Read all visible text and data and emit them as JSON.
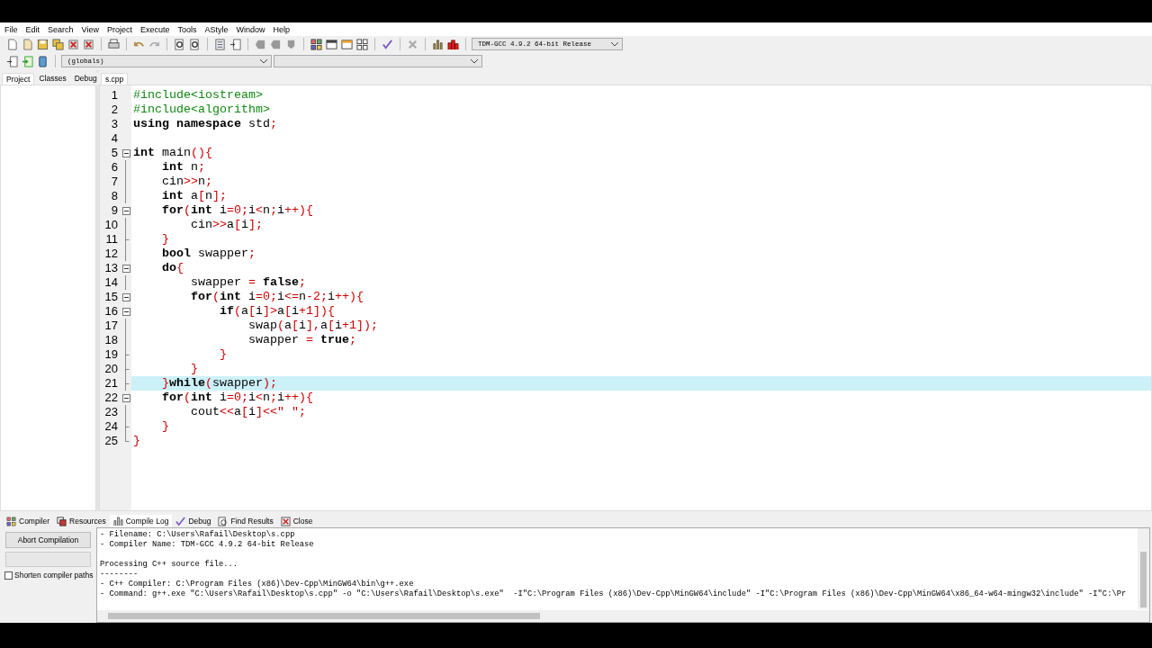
{
  "menu": [
    "File",
    "Edit",
    "Search",
    "View",
    "Project",
    "Execute",
    "Tools",
    "AStyle",
    "Window",
    "Help"
  ],
  "toolbar": {
    "compiler": "TDM-GCC 4.9.2 64-bit Release",
    "scope": "(globals)"
  },
  "side_tabs": [
    {
      "label": "Project",
      "selected": true
    },
    {
      "label": "Classes",
      "selected": false
    },
    {
      "label": "Debug",
      "selected": false
    }
  ],
  "editor_tabs": [
    {
      "label": "s.cpp",
      "selected": true
    }
  ],
  "code": [
    {
      "number": "1",
      "kind": "preprocessor",
      "current": false,
      "text": "#include<iostream>"
    },
    {
      "number": "2",
      "kind": "preprocessor",
      "current": false,
      "text": "#include<algorithm>"
    },
    {
      "number": "3",
      "kind": "plain",
      "current": false,
      "text": "**using namespace** std;"
    },
    {
      "number": "4",
      "kind": "plain",
      "current": false
    },
    {
      "number": "5",
      "kind": "fold-start",
      "current": false,
      "text": "**int** main(){"
    },
    {
      "number": "6",
      "kind": "fold-inside",
      "current": false,
      "text": "    **int** n;"
    },
    {
      "number": "7",
      "kind": "fold-inside",
      "current": false,
      "text": "    cin>>n;"
    },
    {
      "number": "8",
      "kind": "fold-inside",
      "current": false,
      "text": "    **int** a[n];"
    },
    {
      "number": "9",
      "kind": "fold-start",
      "current": false,
      "text": "    **for**(**int** i=0;i<n;i++){"
    },
    {
      "number": "10",
      "kind": "fold-inside",
      "current": false,
      "text": "        cin>>a[i];"
    },
    {
      "number": "11",
      "kind": "fold-end",
      "current": false,
      "text": "    }"
    },
    {
      "number": "12",
      "kind": "fold-inside",
      "current": false,
      "text": "    **bool** swapper;"
    },
    {
      "number": "13",
      "kind": "fold-start",
      "current": false,
      "text": "    **do**{"
    },
    {
      "number": "14",
      "kind": "fold-inside",
      "current": false,
      "text": "        swapper = **false**;"
    },
    {
      "number": "15",
      "kind": "fold-start",
      "current": false,
      "text": "        **for**(**int** i=0;i<=n-2;i++){"
    },
    {
      "number": "16",
      "kind": "fold-start",
      "current": false,
      "text": "            **if**(a[i]>a[i+1]){"
    },
    {
      "number": "17",
      "kind": "fold-inside",
      "current": false,
      "text": "                swap(a[i],a[i+1]);"
    },
    {
      "number": "18",
      "kind": "fold-inside",
      "current": false,
      "text": "                swapper = **true**;"
    },
    {
      "number": "19",
      "kind": "fold-end",
      "current": false,
      "text": "            }"
    },
    {
      "number": "20",
      "kind": "fold-end",
      "current": false,
      "text": "        }"
    },
    {
      "number": "21",
      "kind": "fold-end",
      "current": true,
      "text": "    }**while**(swapper);"
    },
    {
      "number": "22",
      "kind": "fold-start",
      "current": false,
      "text": "    **for**(**int** i=0;i<n;i++){"
    },
    {
      "number": "23",
      "kind": "fold-inside",
      "current": false,
      "text": "        cout<<a[i]<<\" \";"
    },
    {
      "number": "24",
      "kind": "fold-end",
      "current": false,
      "text": "    }"
    },
    {
      "number": "25",
      "kind": "fold-last",
      "current": false,
      "text": "}"
    }
  ],
  "bottom_tabs": [
    {
      "label": "Compiler",
      "selected": false
    },
    {
      "label": "Resources",
      "selected": false
    },
    {
      "label": "Compile Log",
      "selected": true
    },
    {
      "label": "Debug",
      "selected": false
    },
    {
      "label": "Find Results",
      "selected": false
    },
    {
      "label": "Close",
      "selected": false
    }
  ],
  "abort_button": "Abort Compilation",
  "shorten_paths": {
    "label": "Shorten compiler paths",
    "checked": false
  },
  "compile_log": [
    [
      "- Filename: C:\\Users\\Rafail\\Desktop\\s.cpp",
      "- Compiler Name: TDM-GCC 4.9.2 64-bit Release"
    ],
    [
      "Processing C++ source file...",
      "--------",
      "- C++ Compiler: C:\\Program Files (x86)\\Dev-Cpp\\MinGW64\\bin\\g++.exe",
      "- Command: g++.exe \"C:\\Users\\Rafail\\Desktop\\s.cpp\" -o \"C:\\Users\\Rafail\\Desktop\\s.exe\"  -I\"C:\\Program Files (x86)\\Dev-Cpp\\MinGW64\\include\" -I\"C:\\Program Files (x86)\\Dev-Cpp\\MinGW64\\x86_64-w64-mingw32\\include\" -I\"C:\\Pr"
    ]
  ]
}
